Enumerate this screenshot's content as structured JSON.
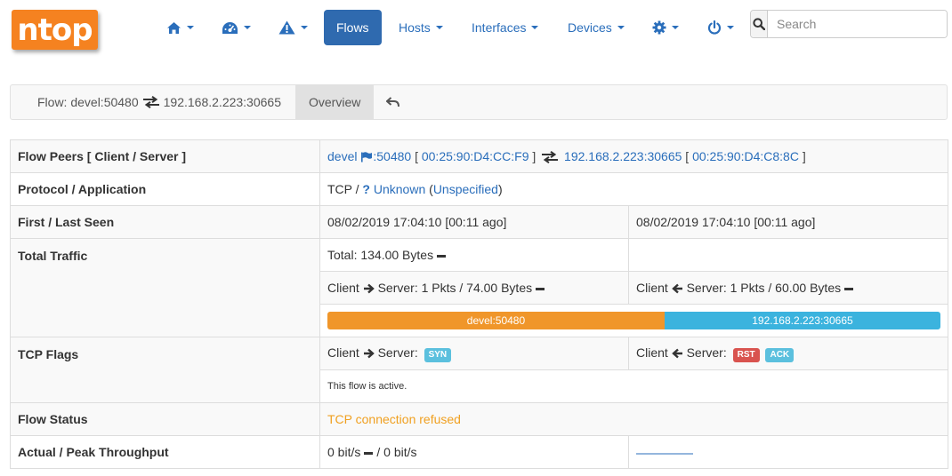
{
  "app": {
    "logo_text": "ntop"
  },
  "navbar": {
    "items": [
      {
        "name": "home",
        "icon": "home-icon"
      },
      {
        "name": "dashboard",
        "icon": "dashboard-icon"
      },
      {
        "name": "alerts",
        "icon": "warning-icon"
      },
      {
        "name": "flows",
        "label": "Flows",
        "active": true
      },
      {
        "name": "hosts",
        "label": "Hosts"
      },
      {
        "name": "interfaces",
        "label": "Interfaces"
      },
      {
        "name": "devices",
        "label": "Devices"
      },
      {
        "name": "settings",
        "icon": "gear-icon"
      },
      {
        "name": "power",
        "icon": "power-icon"
      }
    ],
    "search": {
      "placeholder": "Search",
      "value": ""
    }
  },
  "flow_bar": {
    "title_prefix": "Flow: devel:50480",
    "title_suffix": "192.168.2.223:30665",
    "tab_overview": "Overview"
  },
  "details": {
    "peers": {
      "label": "Flow Peers [ Client / Server ]",
      "client_host": "devel",
      "client_port": ":50480",
      "client_mac": "00:25:90:D4:CC:F9",
      "server": "192.168.2.223:30665",
      "server_mac": "00:25:90:D4:C8:8C"
    },
    "protocol": {
      "label": "Protocol / Application",
      "proto": "TCP /",
      "app": "Unknown",
      "app_detail": "Unspecified"
    },
    "seen": {
      "label": "First / Last Seen",
      "first": "08/02/2019 17:04:10 [00:11 ago]",
      "last": "08/02/2019 17:04:10 [00:11 ago]"
    },
    "traffic": {
      "label": "Total Traffic",
      "total": "Total: 134.00 Bytes",
      "c2s_prefix": "Client",
      "c2s_suffix": "Server: 1 Pkts / 74.00 Bytes",
      "s2c_prefix": "Client",
      "s2c_suffix": "Server: 1 Pkts / 60.00 Bytes",
      "bar_client_label": "devel:50480",
      "bar_client_share": 0.55,
      "bar_server_label": "192.168.2.223:30665",
      "bar_server_share": 0.45,
      "bar_client_color": "#f0962a",
      "bar_server_color": "#3bb3de"
    },
    "tcp_flags": {
      "label": "TCP Flags",
      "c2s_prefix": "Client",
      "c2s_suffix": "Server:",
      "c2s_flags": [
        "SYN"
      ],
      "s2c_prefix": "Client",
      "s2c_suffix": "Server:",
      "s2c_flags": [
        "RST",
        "ACK"
      ],
      "note": "This flow is active."
    },
    "status": {
      "label": "Flow Status",
      "value": "TCP connection refused",
      "color": "#f0a020"
    },
    "throughput": {
      "label": "Actual / Peak Throughput",
      "actual": "0 bit/s",
      "peak": "/ 0 bit/s"
    }
  },
  "colors": {
    "link": "#2a6ebb",
    "nav_active": "#2f6aaf",
    "badge_info": "#5bc0de",
    "badge_danger": "#d9534f",
    "logo": "#f58220"
  }
}
